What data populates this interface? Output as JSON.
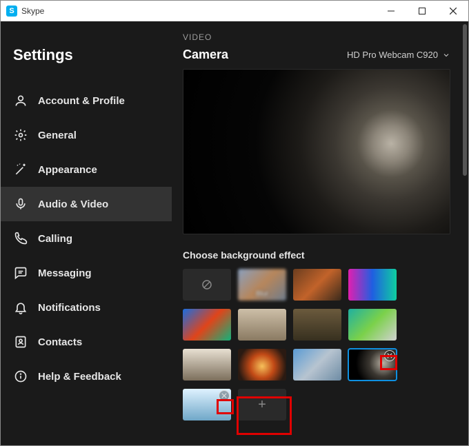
{
  "window": {
    "app_name": "Skype"
  },
  "sidebar": {
    "title": "Settings",
    "items": [
      {
        "label": "Account & Profile"
      },
      {
        "label": "General"
      },
      {
        "label": "Appearance"
      },
      {
        "label": "Audio & Video"
      },
      {
        "label": "Calling"
      },
      {
        "label": "Messaging"
      },
      {
        "label": "Notifications"
      },
      {
        "label": "Contacts"
      },
      {
        "label": "Help & Feedback"
      }
    ],
    "active_index": 3
  },
  "main": {
    "section_label": "VIDEO",
    "camera_label": "Camera",
    "camera_selected": "HD Pro Webcam C920",
    "choose_label": "Choose background effect",
    "tiles": {
      "blur_label": "Blur",
      "add_label": "+"
    }
  }
}
